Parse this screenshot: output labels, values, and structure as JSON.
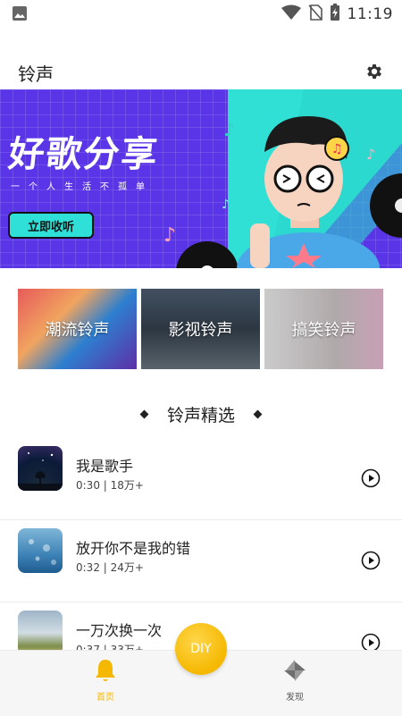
{
  "status_bar": {
    "time": "11:19",
    "icons": [
      "image-icon",
      "wifi-icon",
      "no-sim-icon",
      "battery-charging-icon"
    ]
  },
  "app_bar": {
    "title": "铃声",
    "settings_icon": "gear-icon"
  },
  "banner": {
    "title": "好歌分享",
    "subtitle": "一个人生活不孤单",
    "button_label": "立即收听"
  },
  "categories": [
    {
      "label": "潮流铃声"
    },
    {
      "label": "影视铃声"
    },
    {
      "label": "搞笑铃声"
    }
  ],
  "section": {
    "title": "铃声精选"
  },
  "songs": [
    {
      "name": "我是歌手",
      "meta": "0:30 | 18万+"
    },
    {
      "name": "放开你不是我的错",
      "meta": "0:32 | 24万+"
    },
    {
      "name": "一万次换一次",
      "meta": "0:37 | 33万+"
    }
  ],
  "bottom_nav": {
    "home_label": "首页",
    "diy_label": "DIY",
    "discover_label": "发现"
  },
  "colors": {
    "accent": "#f5b800",
    "banner_bg": "#5a35e8",
    "banner_button": "#2fe0d8"
  }
}
